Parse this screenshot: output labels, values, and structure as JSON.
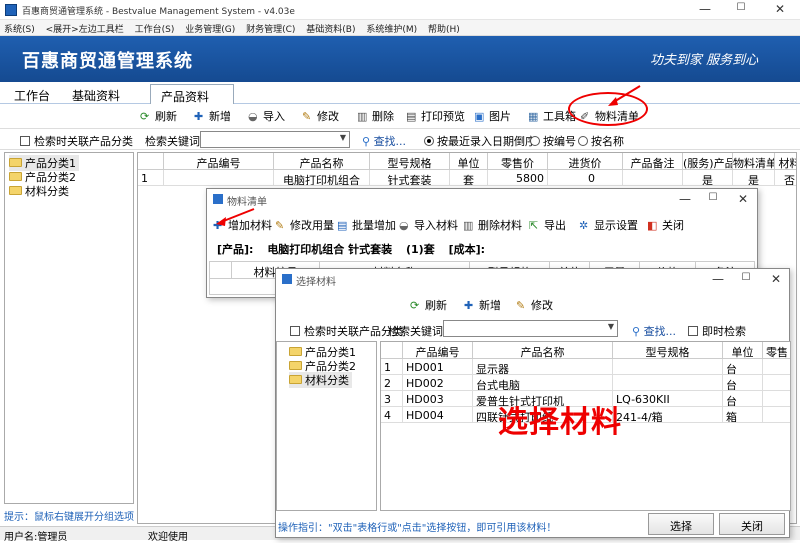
{
  "window": {
    "title": "百惠商贸通管理系统 - Bestvalue Management System - v4.03e",
    "min": "—",
    "max": "☐",
    "close": "✕"
  },
  "menu": [
    "系统(S)",
    "<展开>左边工具栏",
    "工作台(S)",
    "业务管理(G)",
    "财务管理(C)",
    "基础资料(B)",
    "系统维护(M)",
    "帮助(H)"
  ],
  "banner": {
    "title": "百惠商贸通管理系统",
    "slogan": "功夫到家 服务到心"
  },
  "tabs": [
    {
      "label": "工作台"
    },
    {
      "label": "基础资料"
    },
    {
      "label": "产品资料",
      "close": "×"
    }
  ],
  "toolbar": [
    {
      "label": "刷新",
      "icon": "⟳"
    },
    {
      "label": "新增",
      "icon": "✚"
    },
    {
      "label": "导入",
      "icon": "◒"
    },
    {
      "label": "修改",
      "icon": "✎"
    },
    {
      "label": "删除",
      "icon": "▥"
    },
    {
      "label": "打印预览",
      "icon": "▤"
    },
    {
      "label": "图片",
      "icon": "▣"
    },
    {
      "label": "工具箱",
      "icon": "▦"
    },
    {
      "label": "物料清单",
      "icon": "✐"
    }
  ],
  "search": {
    "link_category_label": "检索时关联产品分类",
    "keyword_label": "检索关键词",
    "keyword_value": "",
    "find_label": "查找...",
    "sort_options": [
      "按最近录入日期倒序",
      "按编号",
      "按名称"
    ],
    "sort_selected": 0
  },
  "main_tree": [
    "产品分类1",
    "产品分类2",
    "材料分类"
  ],
  "main_grid": {
    "columns": [
      "产品编号",
      "产品名称",
      "型号规格",
      "单位",
      "零售价",
      "进货价",
      "产品备注",
      "(服务)产品",
      "物料清单",
      "材料"
    ],
    "rows": [
      [
        "1",
        "",
        "电脑打印机组合",
        "针式套装",
        "套",
        "5800",
        "0",
        "",
        "是",
        "是",
        "否"
      ]
    ]
  },
  "hint": "提示：鼠标右键展开分组选项",
  "statusbar": {
    "user": "用户名:管理员",
    "welcome": "欢迎使用"
  },
  "bom": {
    "title": "物料清单",
    "toolbar": [
      {
        "label": "增加材料",
        "icon": "✚"
      },
      {
        "label": "修改用量",
        "icon": "✎"
      },
      {
        "label": "批量增加",
        "icon": "▤"
      },
      {
        "label": "导入材料",
        "icon": "◒"
      },
      {
        "label": "删除材料",
        "icon": "▥"
      },
      {
        "label": "导出",
        "icon": "⇱"
      },
      {
        "label": "显示设置",
        "icon": "✲"
      },
      {
        "label": "关闭",
        "icon": "◧"
      }
    ],
    "info": {
      "product_tag": "[产品]:",
      "product": "电脑打印机组合 针式套装",
      "qty": "(1)套",
      "cost_tag": "[成本]:"
    },
    "columns": [
      "材料编号",
      "材料名称",
      "型号规格",
      "单位",
      "用量",
      "价格",
      "备注"
    ]
  },
  "picker": {
    "title": "选择材料",
    "toolbar": [
      {
        "label": "刷新",
        "icon": "⟳"
      },
      {
        "label": "新增",
        "icon": "✚"
      },
      {
        "label": "修改",
        "icon": "✎"
      }
    ],
    "link_category_label": "检索时关联产品分类",
    "keyword_label": "检索关键词",
    "keyword_value": "",
    "find_label": "查找...",
    "instant_label": "即时检索",
    "tree": [
      "产品分类1",
      "产品分类2",
      "材料分类"
    ],
    "columns": [
      "产品编号",
      "产品名称",
      "型号规格",
      "单位",
      "零售"
    ],
    "rows": [
      [
        "1",
        "HD001",
        "显示器",
        "",
        "台",
        ""
      ],
      [
        "2",
        "HD002",
        "台式电脑",
        "",
        "台",
        ""
      ],
      [
        "3",
        "HD003",
        "爱普生针式打印机",
        "LQ-630KII",
        "台",
        ""
      ],
      [
        "4",
        "HD004",
        "四联针式打印纸",
        "241-4/箱",
        "箱",
        ""
      ]
    ],
    "guide": "操作指引：\"双击\"表格行或\"点击\"选择按钮，即可引用该材料！",
    "select_btn": "选择",
    "close_btn": "关闭"
  },
  "annotations": {
    "overlay_text": "选择材料",
    "color": "#e00000"
  },
  "colors": {
    "banner": "#1a56a5",
    "accent": "#2a6fc9"
  }
}
